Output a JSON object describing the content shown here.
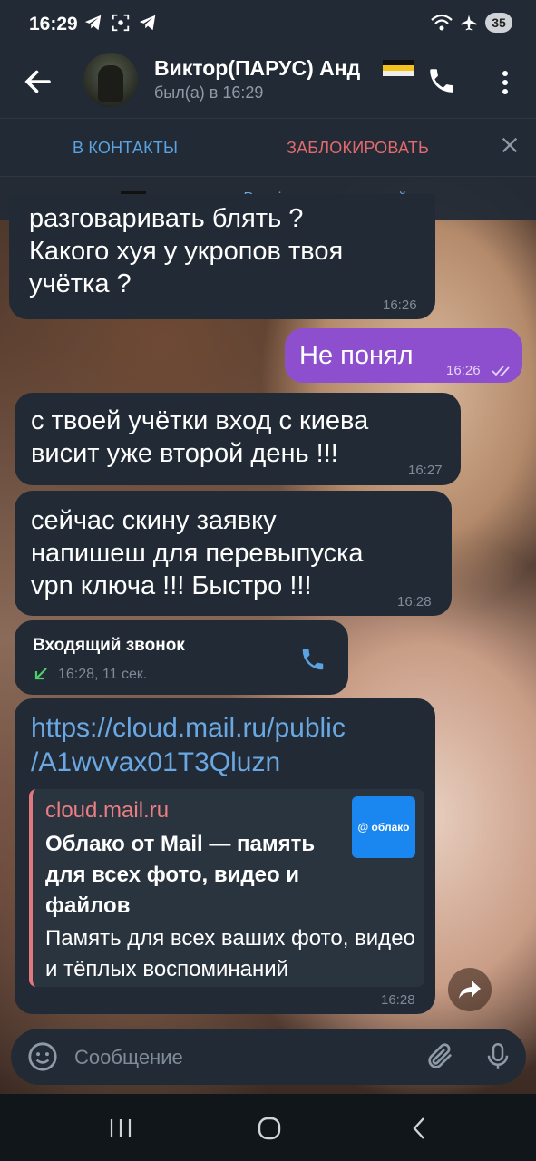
{
  "status_bar": {
    "time": "16:29",
    "battery": "35"
  },
  "header": {
    "title": "Виктор(ПАРУС) Анд",
    "subtitle": "был(а) в 16:29"
  },
  "actions": {
    "add_contact": "В КОНТАКТЫ",
    "block": "ЗАБЛОКИРОВАТЬ"
  },
  "premium_note": {
    "prefix": "— значок для ",
    "link": "Premium-пользователей",
    "chevron": "›"
  },
  "messages": [
    {
      "lines": [
        "разговаривать блять ?",
        "Какого хуя у укропов твоя",
        "учётка ?"
      ],
      "time": "16:26"
    },
    {
      "text": "Не понял",
      "time": "16:26"
    },
    {
      "lines": [
        "с твоей учётки вход с киева",
        "висит уже второй день !!!"
      ],
      "time": "16:27"
    },
    {
      "lines": [
        "сейчас скину заявку",
        "напишеш для перевыпуска",
        "vpn ключа !!! Быстро !!!"
      ],
      "time": "16:28"
    }
  ],
  "call": {
    "title": "Входящий звонок",
    "detail": "16:28, 11 сек."
  },
  "link_message": {
    "url_line1": "https://cloud.mail.ru/public",
    "url_line2": "/A1wvvax01T3Qluzn",
    "site": "cloud.mail.ru",
    "title": "Облако от Mail — память для всех фото, видео и файлов",
    "description": "Память для всех ваших фото, видео и тёплых воспоминаний",
    "logo_text": "@ облако",
    "time": "16:28"
  },
  "composer": {
    "placeholder": "Сообщение"
  },
  "colors": {
    "accent": "#5aa2e0",
    "danger": "#e26a6e",
    "outgoing": "#8e4fcf",
    "incoming": "#222b35"
  }
}
